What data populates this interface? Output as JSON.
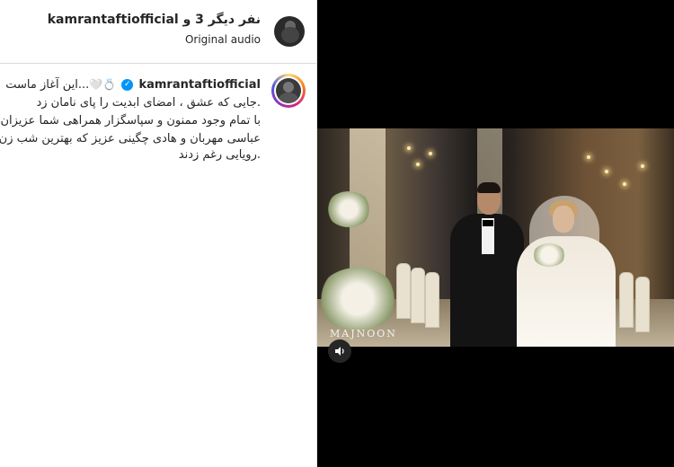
{
  "header": {
    "title": "نفر دیگر 3 و kamrantaftiofficial",
    "subtitle": "Original audio"
  },
  "post": {
    "username": "kamrantaftiofficial",
    "verified": true,
    "caption_lines": [
      "...این آغاز ماست",
      ".جایی که عشق ، امضای ابدیت را پای نامان زد",
      "با تمام وجود ممنون و سپاسگزار همراهی شما عزیزان",
      "عباسی مهربان و هادی چگینی عزیز که بهترین شب زن",
      ".رویایی رغم زدند"
    ],
    "caption_emoji": "💍🤍"
  },
  "video": {
    "watermark": "MAJNOON",
    "mute_icon": "speaker-icon"
  },
  "colors": {
    "verified": "#0095f6",
    "text": "#262626",
    "panel_bg": "#000000"
  }
}
